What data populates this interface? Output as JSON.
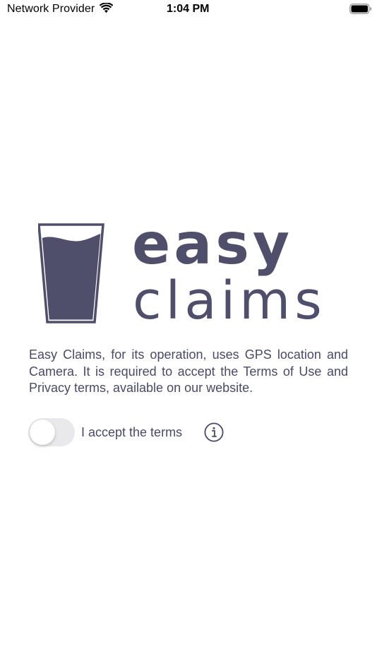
{
  "status_bar": {
    "carrier": "Network Provider",
    "time": "1:04 PM",
    "wifi_icon": "wifi-icon",
    "battery_icon": "battery-icon"
  },
  "logo": {
    "icon": "glass-of-water-icon",
    "word_1": "easy",
    "word_2": "claims",
    "color": "#4f4f6b"
  },
  "description": "Easy Claims, for its operation, uses GPS location and Camera. It is required to accept the Terms of Use and Privacy terms, available on our website.",
  "terms": {
    "toggle_on": false,
    "label": "I accept the terms",
    "info_icon": "info-icon"
  },
  "colors": {
    "text": "#4a4a66",
    "toggle_off_track": "#e9e9eb",
    "background": "#ffffff"
  }
}
